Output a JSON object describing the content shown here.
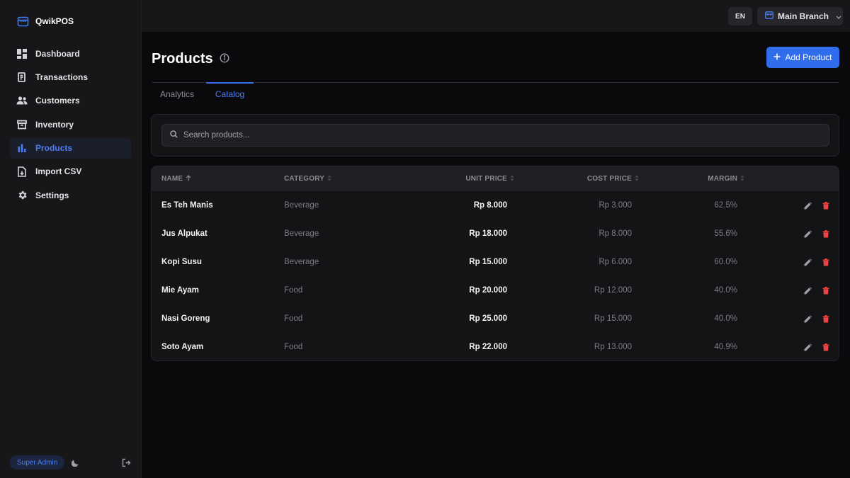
{
  "app": {
    "name": "QwikPOS",
    "logo_icon": "store-icon"
  },
  "sidebar": {
    "items": [
      {
        "label": "Dashboard",
        "icon": "grid-icon",
        "active": false
      },
      {
        "label": "Transactions",
        "icon": "receipt-icon",
        "active": false
      },
      {
        "label": "Customers",
        "icon": "users-icon",
        "active": false
      },
      {
        "label": "Inventory",
        "icon": "archive-box-icon",
        "active": false
      },
      {
        "label": "Products",
        "icon": "bar-chart-icon",
        "active": true
      },
      {
        "label": "Import CSV",
        "icon": "file-import-icon",
        "active": false
      },
      {
        "label": "Settings",
        "icon": "gear-icon",
        "active": false
      }
    ],
    "footer": {
      "role": "Super Admin",
      "theme_icon": "moon-icon",
      "logout_icon": "logout-icon"
    }
  },
  "topbar": {
    "language": "EN",
    "branch": "Main Branch"
  },
  "page": {
    "title": "Products",
    "add_button": "Add Product",
    "tabs": [
      {
        "label": "Analytics",
        "active": false
      },
      {
        "label": "Catalog",
        "active": true
      }
    ],
    "search_placeholder": "Search products..."
  },
  "table": {
    "columns": [
      "NAME",
      "CATEGORY",
      "UNIT PRICE",
      "COST PRICE",
      "MARGIN"
    ],
    "sort_column": "NAME",
    "sort_dir": "asc",
    "rows": [
      {
        "name": "Es Teh Manis",
        "category": "Beverage",
        "unit_price": "Rp 8.000",
        "cost_price": "Rp 3.000",
        "margin": "62.5%"
      },
      {
        "name": "Jus Alpukat",
        "category": "Beverage",
        "unit_price": "Rp 18.000",
        "cost_price": "Rp 8.000",
        "margin": "55.6%"
      },
      {
        "name": "Kopi Susu",
        "category": "Beverage",
        "unit_price": "Rp 15.000",
        "cost_price": "Rp 6.000",
        "margin": "60.0%"
      },
      {
        "name": "Mie Ayam",
        "category": "Food",
        "unit_price": "Rp 20.000",
        "cost_price": "Rp 12.000",
        "margin": "40.0%"
      },
      {
        "name": "Nasi Goreng",
        "category": "Food",
        "unit_price": "Rp 25.000",
        "cost_price": "Rp 15.000",
        "margin": "40.0%"
      },
      {
        "name": "Soto Ayam",
        "category": "Food",
        "unit_price": "Rp 22.000",
        "cost_price": "Rp 13.000",
        "margin": "40.9%"
      }
    ]
  },
  "colors": {
    "accent": "#3a6ff0",
    "danger": "#ef4444",
    "background": "#0a0a0c",
    "sidebar": "#17171a"
  }
}
